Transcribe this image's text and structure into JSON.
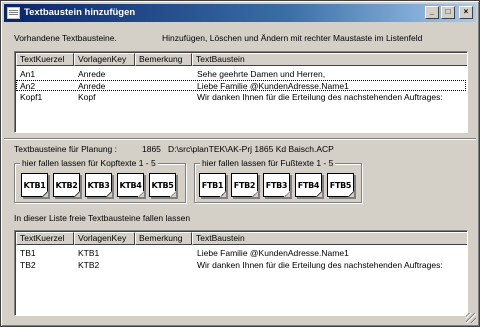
{
  "window": {
    "title": "Textbaustein hinzufügen",
    "minimize_glyph": "_",
    "maximize_glyph": "□",
    "close_glyph": "×"
  },
  "top": {
    "existing_label": "Vorhandene Textbausteine.",
    "hint": "Hinzufügen, Löschen und Ändern mit rechter Maustaste im Listenfeld"
  },
  "columns": [
    "TextKuerzel",
    "VorlagenKey",
    "Bemerkung",
    "TextBaustein"
  ],
  "existing_rows": [
    {
      "kuerzel": "An1",
      "key": "Anrede",
      "bemerkung": "",
      "text": "Sehe geehrte Damen und Herren,"
    },
    {
      "kuerzel": "An2",
      "key": "Anrede",
      "bemerkung": "",
      "text": "Liebe Familie @KundenAdresse.Name1"
    },
    {
      "kuerzel": "Kopf1",
      "key": "Kopf",
      "bemerkung": "",
      "text": "Wir danken Ihnen für die Erteilung des nachstehenden Auftrages:"
    }
  ],
  "planning": {
    "label": "Textbausteine für Planung :",
    "number": "1865",
    "path": "D:\\src\\planTEK\\AK-Prj 1865 Kd Baisch.ACP"
  },
  "kopf_group": {
    "title": "hier fallen lassen für Kopftexte 1 - 5",
    "items": [
      "KTB1",
      "KTB2",
      "KTB3",
      "KTB4",
      "KTB5"
    ]
  },
  "fuss_group": {
    "title": "hier fallen lassen für Fußtexte 1 - 5",
    "items": [
      "FTB1",
      "FTB2",
      "FTB3",
      "FTB4",
      "FTB5"
    ]
  },
  "free": {
    "label": "In dieser Liste freie Textbausteine fallen lassen"
  },
  "free_rows": [
    {
      "kuerzel": "TB1",
      "key": "KTB1",
      "bemerkung": "",
      "text": "Liebe Familie @KundenAdresse.Name1"
    },
    {
      "kuerzel": "TB2",
      "key": "KTB2",
      "bemerkung": "",
      "text": "Wir danken Ihnen für die Erteilung des nachstehenden Auftrages:"
    }
  ]
}
